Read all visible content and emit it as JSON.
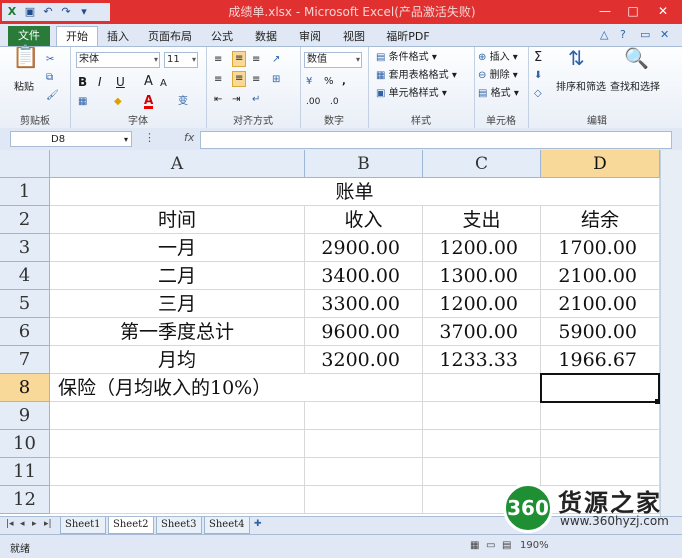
{
  "window": {
    "title": "成绩单.xlsx - Microsoft Excel(产品激活失败)",
    "min": "—",
    "max": "□",
    "close": "✕"
  },
  "tabs": {
    "file": "文件",
    "items": [
      "开始",
      "插入",
      "页面布局",
      "公式",
      "数据",
      "审阅",
      "视图",
      "福昕PDF"
    ]
  },
  "ribbon": {
    "clipboard": {
      "paste": "粘贴",
      "label": "剪贴板"
    },
    "font": {
      "name": "宋体",
      "size": "11",
      "bold": "B",
      "italic": "I",
      "underline": "U",
      "big_a": "A",
      "small_a": "A",
      "wen": "变",
      "label": "字体"
    },
    "align": {
      "label": "对齐方式"
    },
    "number": {
      "format": "数值",
      "percent": "%",
      "comma": ",",
      "label": "数字"
    },
    "styles": {
      "cond": "条件格式",
      "table": "套用表格格式",
      "cell": "单元格样式",
      "label": "样式"
    },
    "cells": {
      "insert": "插入",
      "delete": "删除",
      "format": "格式",
      "label": "单元格"
    },
    "editing": {
      "sigma": "Σ",
      "sort": "排序和筛选",
      "find": "查找和选择",
      "label": "编辑"
    }
  },
  "formula_bar": {
    "name": "D8",
    "fx": "fx",
    "value": ""
  },
  "grid": {
    "columns": [
      "A",
      "B",
      "C",
      "D"
    ],
    "rows": [
      "1",
      "2",
      "3",
      "4",
      "5",
      "6",
      "7",
      "8",
      "9",
      "10",
      "11",
      "12"
    ],
    "title": "账单",
    "header": [
      "时间",
      "收入",
      "支出",
      "结余"
    ],
    "data": [
      [
        "一月",
        "2900.00",
        "1200.00",
        "1700.00"
      ],
      [
        "二月",
        "3400.00",
        "1300.00",
        "2100.00"
      ],
      [
        "三月",
        "3300.00",
        "1200.00",
        "2100.00"
      ],
      [
        "第一季度总计",
        "9600.00",
        "3700.00",
        "5900.00"
      ],
      [
        "月均",
        "3200.00",
        "1233.33",
        "1966.67"
      ]
    ],
    "insurance": "保险（月均收入的10%）",
    "selected_cell": "D8"
  },
  "sheets": [
    "Sheet1",
    "Sheet2",
    "Sheet3",
    "Sheet4"
  ],
  "status": {
    "ready": "就绪",
    "zoom": "190%"
  },
  "watermark": {
    "logo": "360",
    "brand": "货源之家",
    "url": "www.360hyzj.com"
  }
}
